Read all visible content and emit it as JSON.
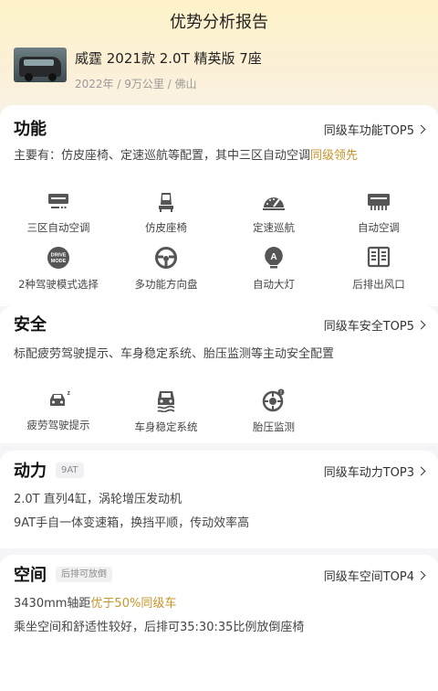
{
  "header": {
    "title": "优势分析报告"
  },
  "car": {
    "name": "威霆 2021款 2.0T 精英版 7座",
    "meta": "2022年 / 9万公里 / 佛山"
  },
  "colors": {
    "highlight": "#c9952c",
    "icon": "#555555"
  },
  "sections": {
    "function": {
      "title": "功能",
      "rank": "同级车功能TOP5",
      "desc_prefix": "主要有：仿皮座椅、定速巡航等配置，其中三区自动空调",
      "desc_highlight": "同级领先",
      "features": [
        {
          "label": "三区自动空调",
          "icon": "tri-zone-ac-icon"
        },
        {
          "label": "仿皮座椅",
          "icon": "leather-seat-icon"
        },
        {
          "label": "定速巡航",
          "icon": "cruise-control-icon"
        },
        {
          "label": "自动空调",
          "icon": "auto-ac-icon"
        },
        {
          "label": "2种驾驶模式选择",
          "icon": "drive-mode-icon",
          "icon_text": "DRIVE MODE"
        },
        {
          "label": "多功能方向盘",
          "icon": "steering-wheel-icon"
        },
        {
          "label": "自动大灯",
          "icon": "auto-headlight-icon",
          "icon_text": "A"
        },
        {
          "label": "后排出风口",
          "icon": "rear-vent-icon"
        }
      ]
    },
    "safety": {
      "title": "安全",
      "rank": "同级车安全TOP5",
      "desc": "标配疲劳驾驶提示、车身稳定系统、胎压监测等主动安全配置",
      "features": [
        {
          "label": "疲劳驾驶提示",
          "icon": "fatigue-warning-icon"
        },
        {
          "label": "车身稳定系统",
          "icon": "stability-control-icon"
        },
        {
          "label": "胎压监测",
          "icon": "tire-pressure-icon"
        }
      ]
    },
    "power": {
      "title": "动力",
      "tag": "9AT",
      "rank": "同级车动力TOP3",
      "line1": "2.0T 直列4缸，涡轮增压发动机",
      "line2": "9AT手自一体变速箱，换挡平顺，传动效率高"
    },
    "space": {
      "title": "空间",
      "tag": "后排可放倒",
      "rank": "同级车空间TOP4",
      "line1_prefix": "3430mm轴距",
      "line1_highlight": "优于50%同级车",
      "line2": "乘坐空间和舒适性较好，后排可35:30:35比例放倒座椅"
    }
  }
}
